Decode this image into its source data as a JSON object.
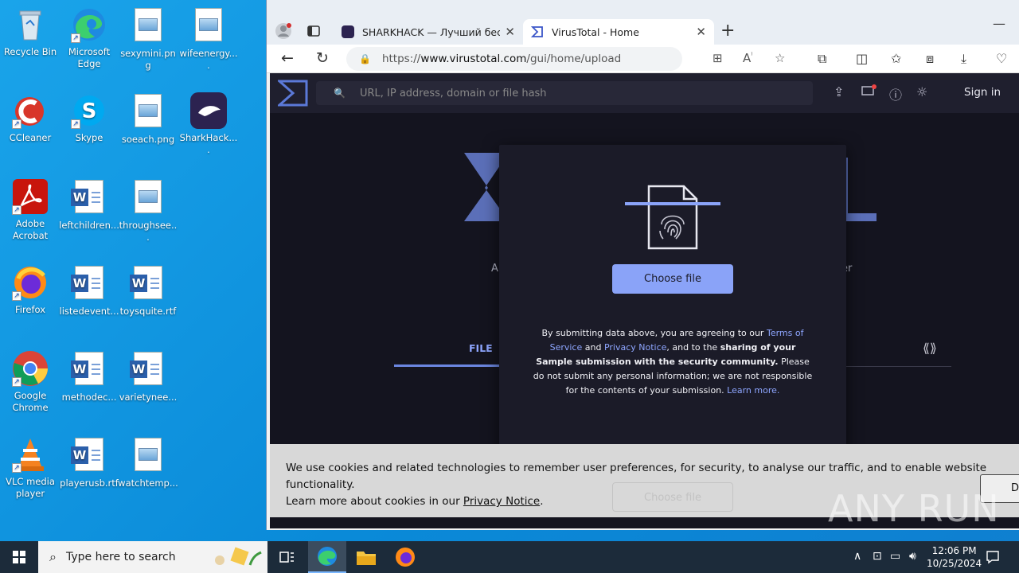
{
  "desktop": {
    "icons": [
      {
        "label": "Recycle Bin"
      },
      {
        "label": "Microsoft Edge"
      },
      {
        "label": "sexymini.png"
      },
      {
        "label": "wifeenergy...."
      },
      {
        "label": "CCleaner"
      },
      {
        "label": "Skype"
      },
      {
        "label": "soeach.png"
      },
      {
        "label": "SharkHack...."
      },
      {
        "label": "Adobe Acrobat"
      },
      {
        "label": "leftchildren..."
      },
      {
        "label": "throughsee..."
      },
      {
        "label": "Firefox"
      },
      {
        "label": "listedevent..."
      },
      {
        "label": "toysquite.rtf"
      },
      {
        "label": "Google Chrome"
      },
      {
        "label": "methodec..."
      },
      {
        "label": "varietynee..."
      },
      {
        "label": "VLC media player"
      },
      {
        "label": "playerusb.rtf"
      },
      {
        "label": "watchtemp..."
      }
    ]
  },
  "browser": {
    "tabs": [
      {
        "title": "SHARKHACK — Лучший беспл",
        "close": "✕"
      },
      {
        "title": "VirusTotal - Home",
        "close": "✕"
      }
    ],
    "new_tab": "+",
    "minimize": "—",
    "url_prefix": "https://",
    "url_host": "www.virustotal.com",
    "url_path": "/gui/home/upload"
  },
  "vt": {
    "search_placeholder": "URL, IP address, domain or file hash",
    "sign_in": "Sign in",
    "tagline_left": "A",
    "tagline_right": "er",
    "file_tab": "FILE",
    "modal": {
      "choose_file": "Choose file",
      "d1": "By submitting data above, you are agreeing to our ",
      "terms": "Terms of Service",
      "d2": " and ",
      "privacy": "Privacy Notice",
      "d3": ", and to the ",
      "d4": "sharing of your Sample submission with the security community.",
      "d5": " Please do not submit any personal information; we are not responsible for the contents of your submission. ",
      "learn_more": "Learn more."
    },
    "cookie": {
      "text1": "We use cookies and related technologies to remember user preferences, for security, to analyse our traffic, and to enable website functionality.",
      "text2": "Learn more about cookies in our ",
      "link": "Privacy Notice",
      "text3": ".",
      "button": "D",
      "ghost_button": "Choose file"
    }
  },
  "watermark": "ANY RUN",
  "taskbar": {
    "search_placeholder": "Type here to search",
    "time": "12:06 PM",
    "date": "10/25/2024"
  },
  "colors": {
    "vt_accent": "#8aa3f8",
    "vt_bg": "#14141f",
    "desktop_bg": "#0a8ad8"
  }
}
